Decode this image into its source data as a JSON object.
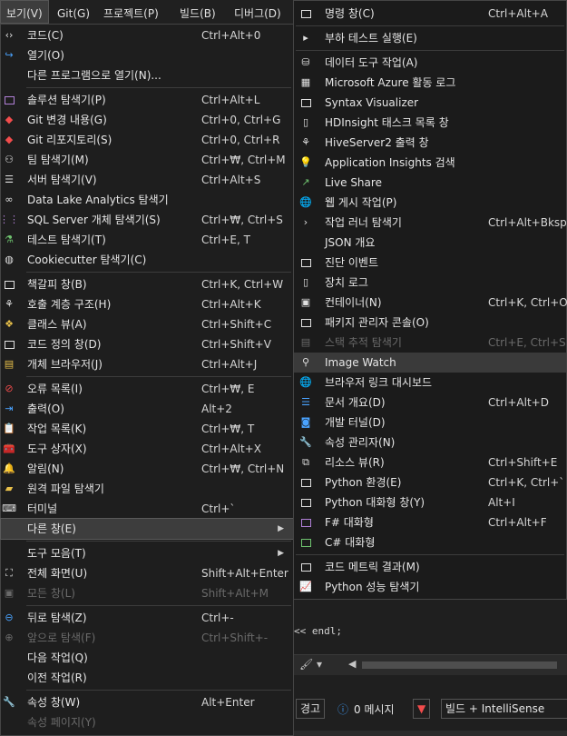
{
  "menubar": {
    "items": [
      {
        "label": "보기(V)"
      },
      {
        "label": "Git(G)"
      },
      {
        "label": "프로젝트(P)"
      },
      {
        "label": "빌드(B)"
      },
      {
        "label": "디버그(D)"
      }
    ]
  },
  "view_menu": {
    "items": [
      {
        "label": "코드(C)",
        "shortcut": "Ctrl+Alt+0",
        "icon": "code-brackets-icon"
      },
      {
        "label": "열기(O)",
        "shortcut": "",
        "icon": "open-arrow-icon"
      },
      {
        "label": "다른 프로그램으로 열기(N)...",
        "shortcut": ""
      },
      {
        "label": "솔루션 탐색기(P)",
        "shortcut": "Ctrl+Alt+L",
        "icon": "solution-explorer-icon"
      },
      {
        "label": "Git 변경 내용(G)",
        "shortcut": "Ctrl+0, Ctrl+G",
        "icon": "git-changes-icon"
      },
      {
        "label": "Git 리포지토리(S)",
        "shortcut": "Ctrl+0, Ctrl+R",
        "icon": "git-repository-icon"
      },
      {
        "label": "팀 탐색기(M)",
        "shortcut": "Ctrl+₩, Ctrl+M",
        "icon": "team-explorer-icon"
      },
      {
        "label": "서버 탐색기(V)",
        "shortcut": "Ctrl+Alt+S",
        "icon": "server-explorer-icon"
      },
      {
        "label": "Data Lake Analytics 탐색기",
        "shortcut": "",
        "icon": "binoculars-icon"
      },
      {
        "label": "SQL Server 개체 탐색기(S)",
        "shortcut": "Ctrl+₩, Ctrl+S",
        "icon": "sql-server-icon"
      },
      {
        "label": "테스트 탐색기(T)",
        "shortcut": "Ctrl+E, T",
        "icon": "test-explorer-icon"
      },
      {
        "label": "Cookiecutter 탐색기(C)",
        "shortcut": "",
        "icon": "cookiecutter-icon"
      },
      {
        "label": "책갈피 창(B)",
        "shortcut": "Ctrl+K, Ctrl+W",
        "icon": "bookmark-icon"
      },
      {
        "label": "호출 계층 구조(H)",
        "shortcut": "Ctrl+Alt+K",
        "icon": "call-hierarchy-icon"
      },
      {
        "label": "클래스 뷰(A)",
        "shortcut": "Ctrl+Shift+C",
        "icon": "class-view-icon"
      },
      {
        "label": "코드 정의 창(D)",
        "shortcut": "Ctrl+Shift+V",
        "icon": "code-definition-icon"
      },
      {
        "label": "개체 브라우저(J)",
        "shortcut": "Ctrl+Alt+J",
        "icon": "object-browser-icon"
      },
      {
        "label": "오류 목록(I)",
        "shortcut": "Ctrl+₩, E",
        "icon": "error-list-icon"
      },
      {
        "label": "출력(O)",
        "shortcut": "Alt+2",
        "icon": "output-icon"
      },
      {
        "label": "작업 목록(K)",
        "shortcut": "Ctrl+₩, T",
        "icon": "task-list-icon"
      },
      {
        "label": "도구 상자(X)",
        "shortcut": "Ctrl+Alt+X",
        "icon": "toolbox-icon"
      },
      {
        "label": "알림(N)",
        "shortcut": "Ctrl+₩, Ctrl+N",
        "icon": "bell-icon"
      },
      {
        "label": "원격 파일 탐색기",
        "shortcut": "",
        "icon": "remote-file-icon"
      },
      {
        "label": "터미널",
        "shortcut": "Ctrl+`",
        "icon": "terminal-icon"
      },
      {
        "label": "다른 창(E)",
        "shortcut": ""
      },
      {
        "label": "도구 모음(T)",
        "shortcut": ""
      },
      {
        "label": "전체 화면(U)",
        "shortcut": "Shift+Alt+Enter",
        "icon": "fullscreen-icon"
      },
      {
        "label": "모든 창(L)",
        "shortcut": "Shift+Alt+M",
        "icon": "all-windows-icon"
      },
      {
        "label": "뒤로 탐색(Z)",
        "shortcut": "Ctrl+-",
        "icon": "navigate-back-icon"
      },
      {
        "label": "앞으로 탐색(F)",
        "shortcut": "Ctrl+Shift+-",
        "icon": "navigate-forward-icon"
      },
      {
        "label": "다음 작업(Q)",
        "shortcut": ""
      },
      {
        "label": "이전 작업(R)",
        "shortcut": ""
      },
      {
        "label": "속성 창(W)",
        "shortcut": "Alt+Enter",
        "icon": "wrench-icon"
      },
      {
        "label": "속성 페이지(Y)",
        "shortcut": ""
      }
    ]
  },
  "other_windows_menu": {
    "items": [
      {
        "label": "명령 창(C)",
        "shortcut": "Ctrl+Alt+A",
        "icon": "command-window-icon"
      },
      {
        "label": "부하 테스트 실행(E)",
        "shortcut": "",
        "icon": "load-test-icon"
      },
      {
        "label": "데이터 도구 작업(A)",
        "shortcut": "",
        "icon": "data-tools-icon"
      },
      {
        "label": "Microsoft Azure 활동 로그",
        "shortcut": "",
        "icon": "azure-log-icon"
      },
      {
        "label": "Syntax Visualizer",
        "shortcut": "",
        "icon": "syntax-visualizer-icon"
      },
      {
        "label": "HDInsight 태스크 목록 창",
        "shortcut": "",
        "icon": "hdinsight-icon"
      },
      {
        "label": "HiveServer2 출력 창",
        "shortcut": "",
        "icon": "hiveserver-icon"
      },
      {
        "label": "Application Insights 검색",
        "shortcut": "",
        "icon": "lightbulb-icon"
      },
      {
        "label": "Live Share",
        "shortcut": "",
        "icon": "live-share-icon"
      },
      {
        "label": "웹 게시 작업(P)",
        "shortcut": "",
        "icon": "globe-icon"
      },
      {
        "label": "작업 러너 탐색기",
        "shortcut": "Ctrl+Alt+Bkspce",
        "icon": "chevron-right-icon"
      },
      {
        "label": "JSON 개요",
        "shortcut": ""
      },
      {
        "label": "진단 이벤트",
        "shortcut": "",
        "icon": "diagnostic-icon"
      },
      {
        "label": "장치 로그",
        "shortcut": "",
        "icon": "device-log-icon"
      },
      {
        "label": "컨테이너(N)",
        "shortcut": "Ctrl+K, Ctrl+O",
        "icon": "container-icon"
      },
      {
        "label": "패키지 관리자 콘솔(O)",
        "shortcut": "",
        "icon": "package-console-icon"
      },
      {
        "label": "스택 추적 탐색기",
        "shortcut": "Ctrl+E, Ctrl+S",
        "icon": "stack-trace-icon"
      },
      {
        "label": "Image Watch",
        "shortcut": "",
        "icon": "search-icon"
      },
      {
        "label": "브라우저 링크 대시보드",
        "shortcut": "",
        "icon": "browser-link-icon"
      },
      {
        "label": "문서 개요(D)",
        "shortcut": "Ctrl+Alt+D",
        "icon": "document-outline-icon"
      },
      {
        "label": "개발 터널(D)",
        "shortcut": "",
        "icon": "dev-tunnel-icon"
      },
      {
        "label": "속성 관리자(N)",
        "shortcut": "",
        "icon": "wrench-icon"
      },
      {
        "label": "리소스 뷰(R)",
        "shortcut": "Ctrl+Shift+E",
        "icon": "resource-view-icon"
      },
      {
        "label": "Python 환경(E)",
        "shortcut": "Ctrl+K, Ctrl+`",
        "icon": "python-env-icon"
      },
      {
        "label": "Python 대화형 창(Y)",
        "shortcut": "Alt+I",
        "icon": "python-interactive-icon"
      },
      {
        "label": "F# 대화형",
        "shortcut": "Ctrl+Alt+F",
        "icon": "fsharp-interactive-icon"
      },
      {
        "label": "C# 대화형",
        "shortcut": "",
        "icon": "csharp-interactive-icon"
      },
      {
        "label": "코드 메트릭 결과(M)",
        "shortcut": "",
        "icon": "code-metrics-icon"
      },
      {
        "label": "Python 성능 탐색기",
        "shortcut": "",
        "icon": "python-performance-icon"
      }
    ]
  },
  "background": {
    "code_text": "<< endl;",
    "warnings_label": "경고",
    "messages_label": "0 메시지",
    "build_filter": "빌드 + IntelliSense"
  },
  "colors": {
    "menu_bg": "#1e1e1e",
    "hover_bg": "#3d3d3d",
    "accent_blue": "#4aa3ff",
    "accent_red": "#f14c4c"
  }
}
